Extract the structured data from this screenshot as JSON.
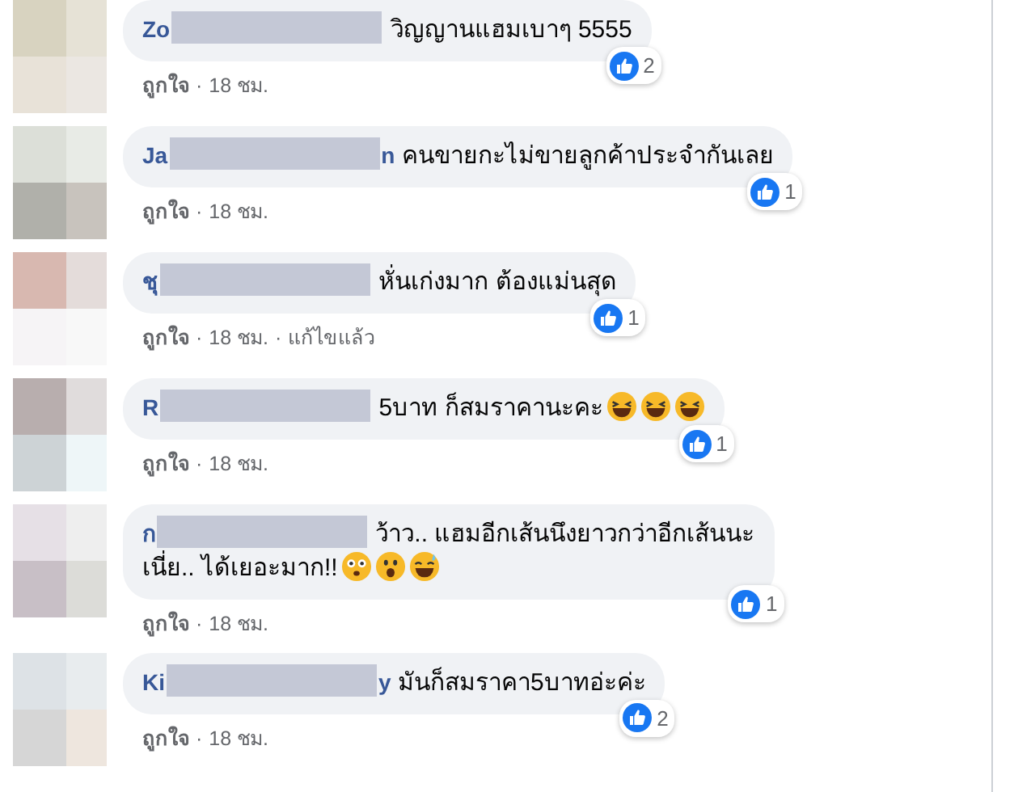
{
  "comments": [
    {
      "name_start": "Zo",
      "text_lines": [
        "วิญญานแฮมเบาๆ 5555"
      ],
      "likes": "2",
      "meta": [
        {
          "kind": "action",
          "text": "ถูกใจ"
        },
        {
          "kind": "dot",
          "text": "·"
        },
        {
          "kind": "time",
          "text": "18 ชม."
        }
      ]
    },
    {
      "name_start": "Ja",
      "name_end": "n",
      "text_lines": [
        "คนขายกะไม่ขายลูกค้าประจำกันเลย"
      ],
      "likes": "1",
      "meta": [
        {
          "kind": "action",
          "text": "ถูกใจ"
        },
        {
          "kind": "dot",
          "text": "·"
        },
        {
          "kind": "time",
          "text": "18 ชม."
        }
      ]
    },
    {
      "name_start": "ชุ",
      "text_lines": [
        "หั่นเก่งมาก ต้องแม่นสุด"
      ],
      "likes": "1",
      "meta": [
        {
          "kind": "action",
          "text": "ถูกใจ"
        },
        {
          "kind": "dot",
          "text": "·"
        },
        {
          "kind": "time",
          "text": "18 ชม."
        },
        {
          "kind": "dot",
          "text": "·"
        },
        {
          "kind": "edited",
          "text": "แก้ไขแล้ว"
        }
      ]
    },
    {
      "name_start": "R",
      "text_lines": [
        "5บาท ก็สมราคานะคะ"
      ],
      "emojis": [
        {
          "kind": "laugh"
        },
        {
          "kind": "laugh"
        },
        {
          "kind": "laugh"
        }
      ],
      "likes": "1",
      "meta": [
        {
          "kind": "action",
          "text": "ถูกใจ"
        },
        {
          "kind": "dot",
          "text": "·"
        },
        {
          "kind": "time",
          "text": "18 ชม."
        }
      ]
    },
    {
      "name_start": "ก",
      "text_lines": [
        "ว้าว.. แฮมอีกเส้นนึงยาวกว่าอีกเส้นนะ",
        "เนี่ย.. ได้เยอะมาก!!"
      ],
      "emojis": [
        {
          "kind": "flushed"
        },
        {
          "kind": "surprised"
        },
        {
          "kind": "sweat"
        }
      ],
      "likes": "1",
      "meta": [
        {
          "kind": "action",
          "text": "ถูกใจ"
        },
        {
          "kind": "dot",
          "text": "·"
        },
        {
          "kind": "time",
          "text": "18 ชม."
        }
      ]
    },
    {
      "name_start": "Ki",
      "name_end": "y",
      "text_lines": [
        "มันก็สมราคา5บาทอ่ะค่ะ"
      ],
      "likes": "2",
      "meta": [
        {
          "kind": "action",
          "text": "ถูกใจ"
        },
        {
          "kind": "dot",
          "text": "·"
        },
        {
          "kind": "time",
          "text": "18 ชม."
        }
      ]
    }
  ]
}
